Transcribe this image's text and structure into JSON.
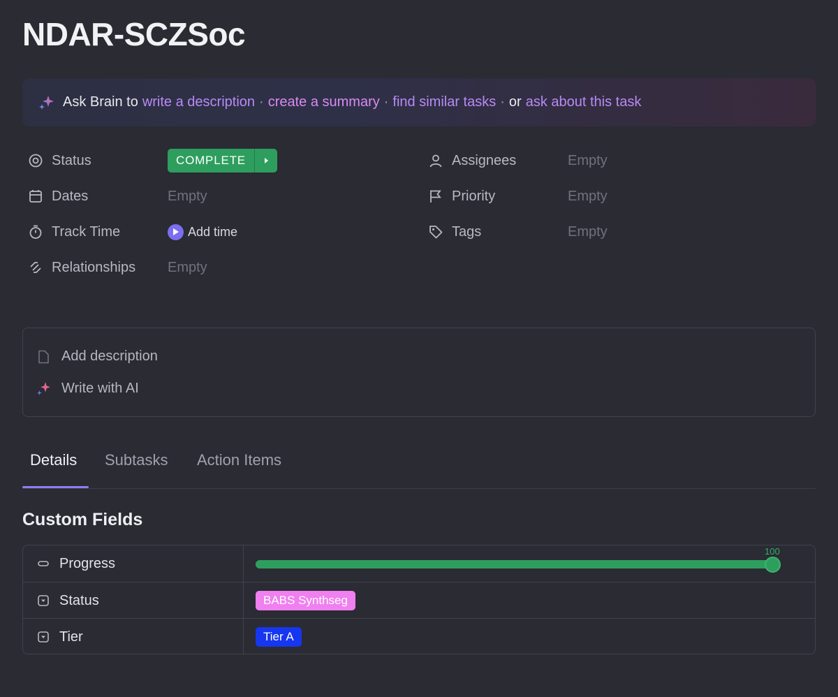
{
  "task": {
    "title": "NDAR-SCZSoc"
  },
  "brain": {
    "prefix": "Ask Brain to",
    "links": [
      "write a description",
      "create a summary",
      "find similar tasks"
    ],
    "or": "or",
    "last_link": "ask about this task",
    "sep": "·"
  },
  "properties": {
    "status": {
      "label": "Status",
      "value": "COMPLETE",
      "color": "#2e9e5e"
    },
    "dates": {
      "label": "Dates",
      "value": "Empty"
    },
    "track_time": {
      "label": "Track Time",
      "value": "Add time"
    },
    "relationships": {
      "label": "Relationships",
      "value": "Empty"
    },
    "assignees": {
      "label": "Assignees",
      "value": "Empty"
    },
    "priority": {
      "label": "Priority",
      "value": "Empty"
    },
    "tags": {
      "label": "Tags",
      "value": "Empty"
    }
  },
  "description": {
    "add_label": "Add description",
    "ai_label": "Write with AI"
  },
  "tabs": [
    {
      "label": "Details",
      "active": true
    },
    {
      "label": "Subtasks",
      "active": false
    },
    {
      "label": "Action Items",
      "active": false
    }
  ],
  "custom_fields": {
    "title": "Custom Fields",
    "progress": {
      "label": "Progress",
      "value": 100,
      "value_text": "100"
    },
    "status": {
      "label": "Status",
      "value": "BABS Synthseg",
      "color": "#f07ff0"
    },
    "tier": {
      "label": "Tier",
      "value": "Tier A",
      "color": "#1636f0"
    }
  },
  "colors": {
    "accent": "#8b7ff0",
    "complete": "#2e9e5e",
    "background": "#2a2b33"
  }
}
